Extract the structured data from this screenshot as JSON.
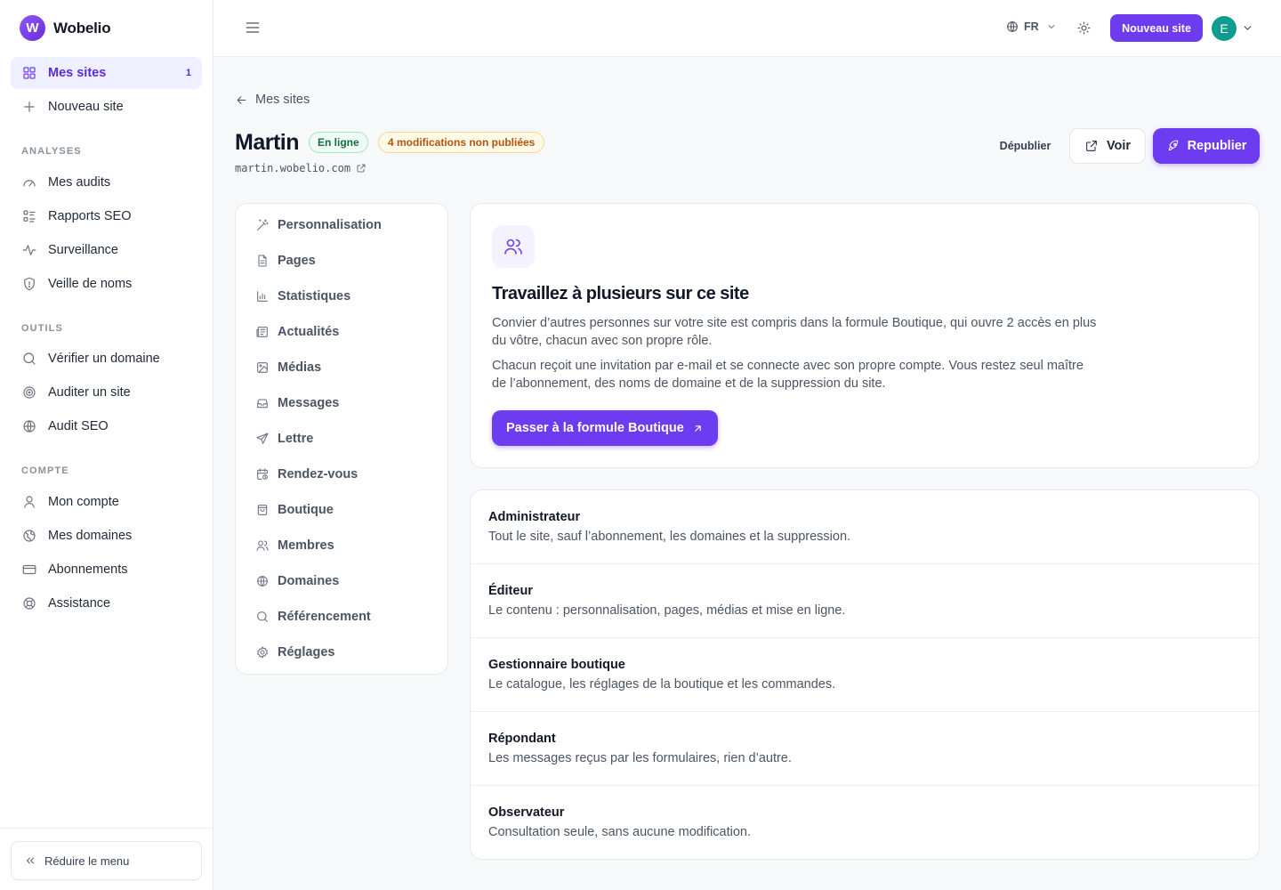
{
  "brand": {
    "name": "Wobelio",
    "logo_letter": "W"
  },
  "colors": {
    "accent": "#6d3cf0",
    "online_badge": "#166c43",
    "pending_badge": "#b4540a",
    "avatar": "#0f9b8e"
  },
  "sidebar": {
    "primary": [
      {
        "label": "Mes sites",
        "badge": "1",
        "icon": "grid-icon",
        "active": true
      },
      {
        "label": "Nouveau site",
        "icon": "plus-icon"
      }
    ],
    "sections": [
      {
        "title": "ANALYSES",
        "items": [
          {
            "label": "Mes audits",
            "icon": "gauge-icon"
          },
          {
            "label": "Rapports SEO",
            "icon": "report-list-icon"
          },
          {
            "label": "Surveillance",
            "icon": "pulse-icon"
          },
          {
            "label": "Veille de noms",
            "icon": "shield-icon"
          }
        ]
      },
      {
        "title": "OUTILS",
        "items": [
          {
            "label": "Vérifier un domaine",
            "icon": "search-icon"
          },
          {
            "label": "Auditer un site",
            "icon": "target-icon"
          },
          {
            "label": "Audit SEO",
            "icon": "globe-icon"
          }
        ]
      },
      {
        "title": "COMPTE",
        "items": [
          {
            "label": "Mon compte",
            "icon": "user-icon"
          },
          {
            "label": "Mes domaines",
            "icon": "network-globe-icon"
          },
          {
            "label": "Abonnements",
            "icon": "credit-card-icon"
          },
          {
            "label": "Assistance",
            "icon": "lifebuoy-icon"
          }
        ]
      }
    ],
    "collapse_label": "Réduire le menu"
  },
  "topbar": {
    "language": "FR",
    "new_site_label": "Nouveau site",
    "avatar_initial": "E"
  },
  "page": {
    "back_label": "Mes sites",
    "site_name": "Martin",
    "status_badge": "En ligne",
    "pending_badge": "4 modifications non publiées",
    "site_url": "martin.wobelio.com",
    "unpublish_label": "Dépublier",
    "view_label": "Voir",
    "republish_label": "Republier"
  },
  "subnav": [
    {
      "label": "Personnalisation",
      "icon": "magic-wand-icon"
    },
    {
      "label": "Pages",
      "icon": "file-icon"
    },
    {
      "label": "Statistiques",
      "icon": "bar-chart-icon"
    },
    {
      "label": "Actualités",
      "icon": "newspaper-icon"
    },
    {
      "label": "Médias",
      "icon": "image-icon"
    },
    {
      "label": "Messages",
      "icon": "inbox-icon"
    },
    {
      "label": "Lettre",
      "icon": "send-icon"
    },
    {
      "label": "Rendez-vous",
      "icon": "calendar-clock-icon"
    },
    {
      "label": "Boutique",
      "icon": "shopping-bag-icon"
    },
    {
      "label": "Membres",
      "icon": "users-icon"
    },
    {
      "label": "Domaines",
      "icon": "globe-icon"
    },
    {
      "label": "Référencement",
      "icon": "search-icon"
    },
    {
      "label": "Réglages",
      "icon": "gear-icon"
    }
  ],
  "promo": {
    "title": "Travaillez à plusieurs sur ce site",
    "paragraph_1": "Convier d’autres personnes sur votre site est compris dans la formule Boutique, qui ouvre 2 accès en plus du vôtre, chacun avec son propre rôle.",
    "paragraph_2": "Chacun reçoit une invitation par e-mail et se connecte avec son propre compte. Vous restez seul maître de l’abonnement, des noms de domaine et de la suppression du site.",
    "cta_label": "Passer à la formule Boutique"
  },
  "roles": [
    {
      "name": "Administrateur",
      "description": "Tout le site, sauf l’abonnement, les domaines et la suppression."
    },
    {
      "name": "Éditeur",
      "description": "Le contenu : personnalisation, pages, médias et mise en ligne."
    },
    {
      "name": "Gestionnaire boutique",
      "description": "Le catalogue, les réglages de la boutique et les commandes."
    },
    {
      "name": "Répondant",
      "description": "Les messages reçus par les formulaires, rien d’autre."
    },
    {
      "name": "Observateur",
      "description": "Consultation seule, sans aucune modification."
    }
  ]
}
